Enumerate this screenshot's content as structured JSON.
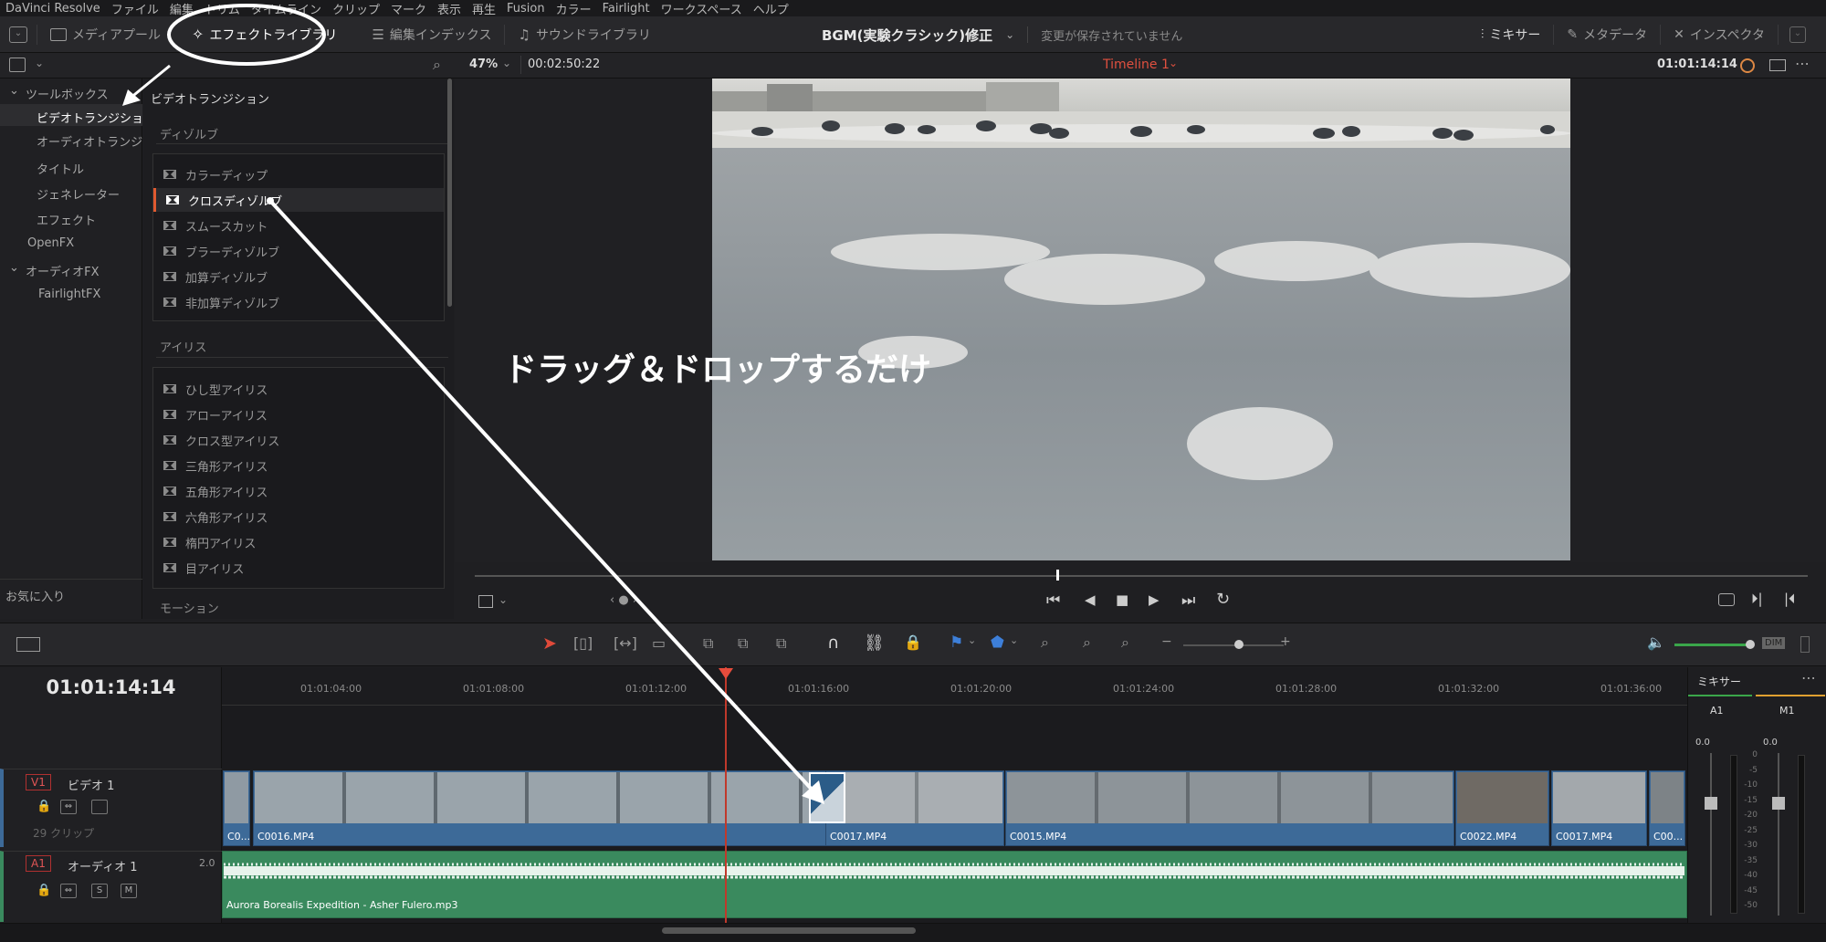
{
  "menu": [
    "DaVinci Resolve",
    "ファイル",
    "編集",
    "トリム",
    "タイムライン",
    "クリップ",
    "マーク",
    "表示",
    "再生",
    "Fusion",
    "カラー",
    "Fairlight",
    "ワークスペース",
    "ヘルプ"
  ],
  "toolbar": {
    "media_pool": "メディアプール",
    "effects_library": "エフェクトライブラリ",
    "edit_index": "編集インデックス",
    "sound_library": "サウンドライブラリ",
    "mixer": "ミキサー",
    "metadata": "メタデータ",
    "inspector": "インスペクタ"
  },
  "project": {
    "title": "BGM(実験クラシック)修正",
    "status": "変更が保存されていません"
  },
  "viewer": {
    "zoom": "47%",
    "timecode_left": "00:02:50:22",
    "timeline_name": "Timeline 1",
    "timecode_right": "01:01:14:14"
  },
  "tree": {
    "toolbox": "ツールボックス",
    "items": [
      "ビデオトランジション",
      "オーディオトランジ...",
      "タイトル",
      "ジェネレーター",
      "エフェクト"
    ],
    "openfx": "OpenFX",
    "audiofx": "オーディオFX",
    "fairlightfx": "FairlightFX",
    "favorites": "お気に入り"
  },
  "effects": {
    "header": "ビデオトランジション",
    "dissolve_title": "ディゾルブ",
    "dissolve": [
      "カラーディップ",
      "クロスディゾルブ",
      "スムースカット",
      "ブラーディゾルブ",
      "加算ディゾルブ",
      "非加算ディゾルブ"
    ],
    "iris_title": "アイリス",
    "iris": [
      "ひし型アイリス",
      "アローアイリス",
      "クロス型アイリス",
      "三角形アイリス",
      "五角形アイリス",
      "六角形アイリス",
      "楕円アイリス",
      "目アイリス"
    ],
    "motion_title": "モーション"
  },
  "annotation": "ドラッグ＆ドロップするだけ",
  "timeline": {
    "timecode": "01:01:14:14",
    "ruler": [
      "01:01:04:00",
      "01:01:08:00",
      "01:01:12:00",
      "01:01:16:00",
      "01:01:20:00",
      "01:01:24:00",
      "01:01:28:00",
      "01:01:32:00",
      "01:01:36:00"
    ],
    "v1_badge": "V1",
    "v1_name": "ビデオ 1",
    "v1_count": "29 クリップ",
    "a1_badge": "A1",
    "a1_name": "オーディオ 1",
    "a1_level": "2.0",
    "solo": "S",
    "mute": "M",
    "clips": [
      "C0...",
      "C0016.MP4",
      "C0017.MP4",
      "C0015.MP4",
      "C0022.MP4",
      "C0017.MP4",
      "C00..."
    ],
    "audio_clip": "Aurora Borealis Expedition - Asher Fulero.mp3"
  },
  "mixer": {
    "title": "ミキサー",
    "ch1": "A1",
    "ch2": "M1",
    "val1": "0.0",
    "val2": "0.0",
    "scale": [
      "0",
      "-5",
      "-10",
      "-15",
      "-20",
      "-25",
      "-30",
      "-35",
      "-40",
      "-45",
      "-50"
    ]
  },
  "timeline_toolbar": {
    "dim": "DIM"
  }
}
